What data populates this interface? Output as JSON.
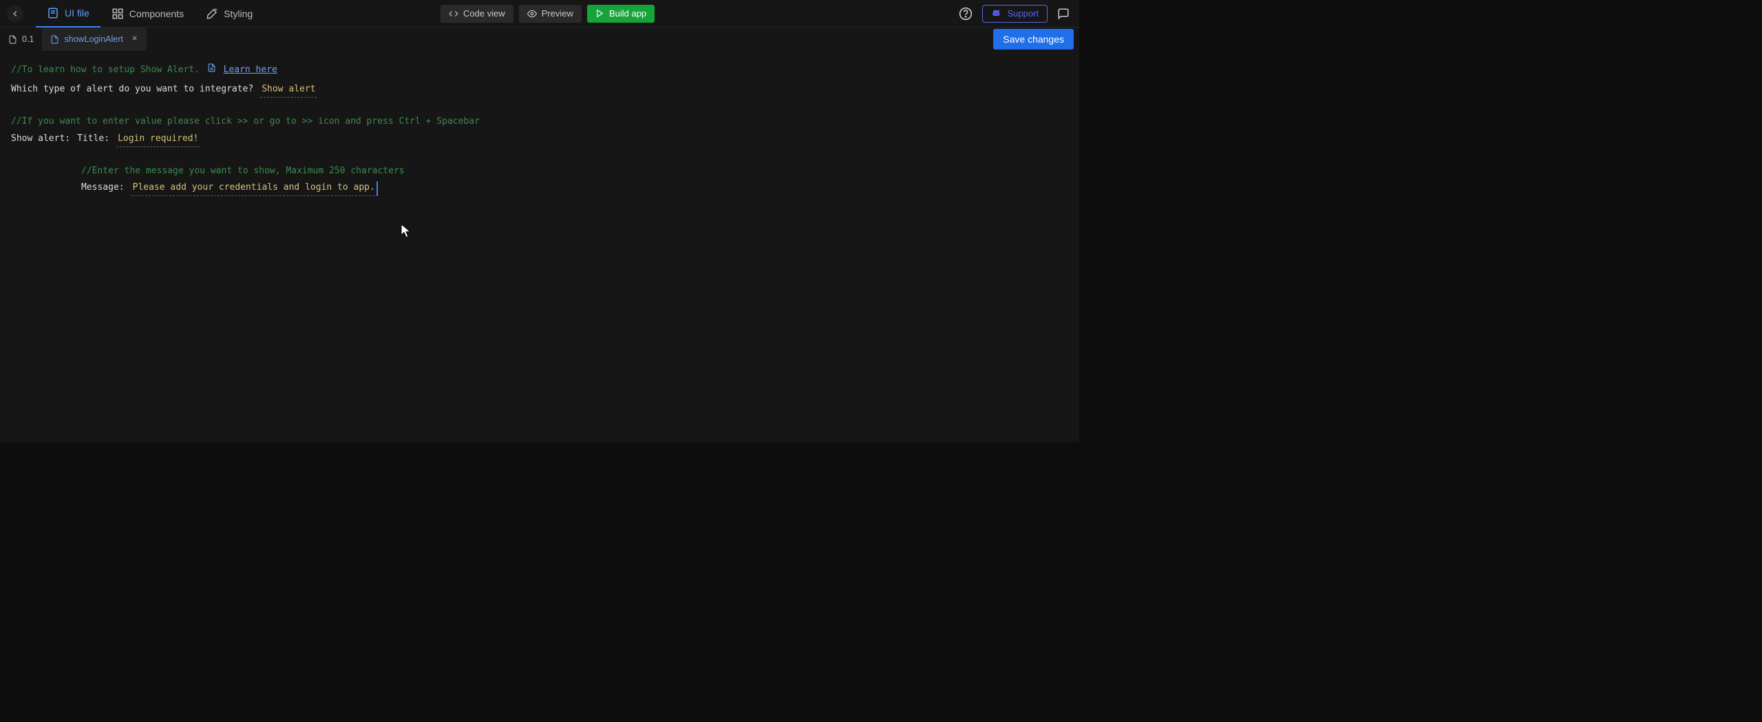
{
  "topbar": {
    "tabs": {
      "ui_file": "UI file",
      "components": "Components",
      "styling": "Styling"
    },
    "code_view": "Code view",
    "preview": "Preview",
    "build_app": "Build app",
    "support": "Support"
  },
  "filebar": {
    "version": "0.1",
    "open_tab": "showLoginAlert",
    "save": "Save changes"
  },
  "editor": {
    "setup_comment": "//To learn how to setup Show Alert.",
    "learn_link": "Learn here",
    "question": "Which type of alert do you want to integrate?",
    "alert_type": "Show alert",
    "hint_comment": "//If you want to enter value please click >> or go to >> icon and press Ctrl + Spacebar",
    "show_alert_label": "Show alert:",
    "title_label": "Title:",
    "title_value": "Login required!",
    "message_hint": "//Enter the message you want to show, Maximum 250 characters",
    "message_label": "Message:",
    "message_value": "Please add your credentials and login to app."
  },
  "icons": {
    "back": "chevron-left-icon",
    "ui_file": "file-icon",
    "components": "grid-icon",
    "styling": "wand-icon",
    "code_view": "code-icon",
    "preview": "eye-icon",
    "build": "play-icon",
    "help": "help-icon",
    "discord": "discord-icon",
    "chat": "chat-icon",
    "doc": "document-icon",
    "close": "close-icon"
  },
  "colors": {
    "accent_blue": "#1f6feb",
    "accent_green": "#15a33a",
    "comment_green": "#3e8a4a",
    "editable_yellow": "#d6c178",
    "link_blue": "#6aa0ef",
    "discord_purple": "#5865f2"
  }
}
